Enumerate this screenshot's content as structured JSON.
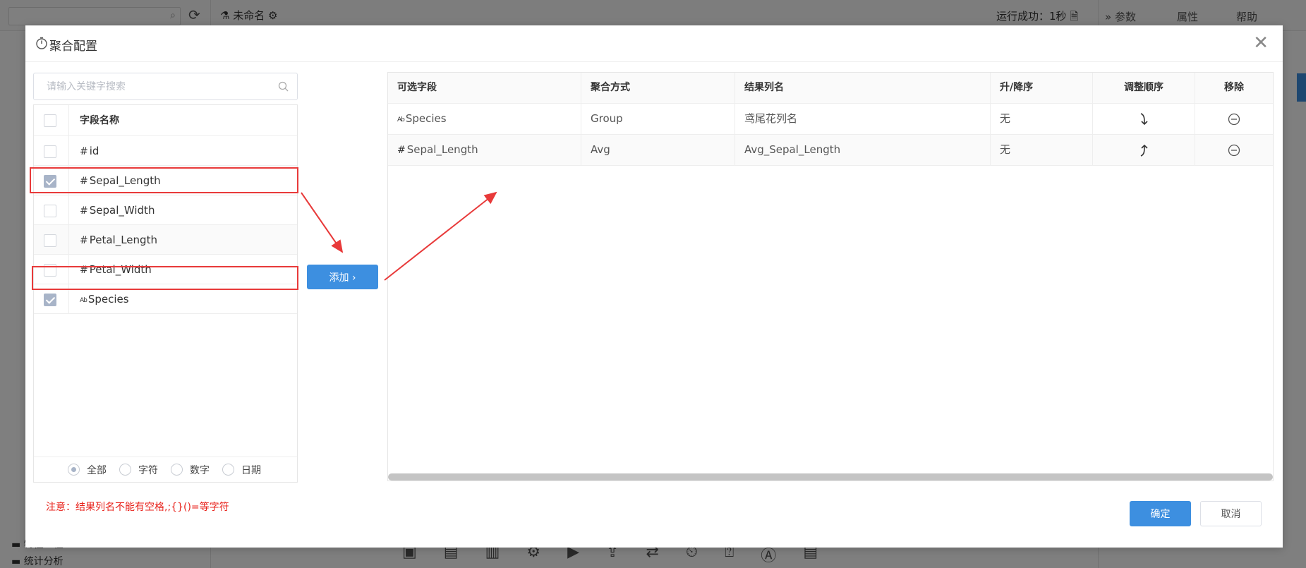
{
  "background": {
    "project_name": "未命名",
    "status": "运行成功：1秒",
    "tabs": [
      "参数",
      "属性",
      "帮助"
    ],
    "folders": [
      "特征工程",
      "统计分析"
    ]
  },
  "dialog": {
    "title": "聚合配置",
    "search_placeholder": "请输入关键字搜索",
    "field_list": {
      "header": "字段名称",
      "rows": [
        {
          "type": "#",
          "name": "id",
          "checked": false
        },
        {
          "type": "#",
          "name": "Sepal_Length",
          "checked": true
        },
        {
          "type": "#",
          "name": "Sepal_Width",
          "checked": false
        },
        {
          "type": "#",
          "name": "Petal_Length",
          "checked": false
        },
        {
          "type": "#",
          "name": "Petal_Width",
          "checked": false
        },
        {
          "type": "Ab",
          "name": "Species",
          "checked": true
        }
      ]
    },
    "filters": {
      "all": "全部",
      "string": "字符",
      "number": "数字",
      "date": "日期",
      "selected": "all"
    },
    "add_button": "添加 ›",
    "table": {
      "columns": [
        "可选字段",
        "聚合方式",
        "结果列名",
        "升/降序",
        "调整顺序",
        "移除"
      ],
      "rows": [
        {
          "field_type": "Ab",
          "field": "Species",
          "agg": "Group",
          "result": "鸢尾花列名",
          "order": "无"
        },
        {
          "field_type": "#",
          "field": "Sepal_Length",
          "agg": "Avg",
          "result": "Avg_Sepal_Length",
          "order": "无"
        }
      ]
    },
    "note": "注意：结果列名不能有空格,;{}()=等字符",
    "ok_button": "确定",
    "cancel_button": "取消"
  },
  "colors": {
    "primary": "#3d8fe0",
    "highlight": "#e83a3a",
    "note": "#e8231c"
  }
}
